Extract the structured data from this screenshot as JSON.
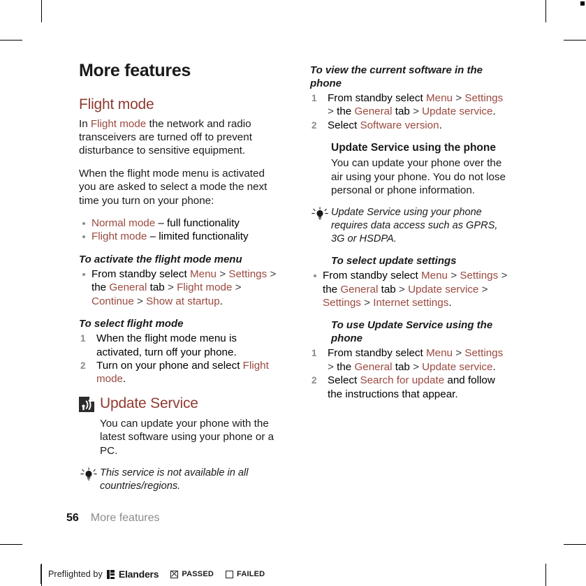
{
  "document": {
    "chapter_title": "More features",
    "folio_number": "56",
    "folio_label": "More features"
  },
  "left_column": {
    "flight_mode": {
      "heading": "Flight mode",
      "intro_pre": "In ",
      "intro_term": "Flight mode",
      "intro_post": " the network and radio transceivers are turned off to prevent disturbance to sensitive equipment.",
      "paragraph2": "When the flight mode menu is activated you are asked to select a mode the next time you turn on your phone:",
      "modes": [
        {
          "term": "Normal mode",
          "desc": " – full functionality"
        },
        {
          "term": "Flight mode",
          "desc": " – limited functionality"
        }
      ],
      "activate": {
        "title": "To activate the flight mode menu",
        "step_pre": "From standby select ",
        "menu": "Menu",
        "settings": "Settings",
        "the": "the ",
        "general": "General",
        "tab": " tab ",
        "flight_mode": "Flight mode",
        "continue": "Continue",
        "show_at_startup": "Show at startup",
        "period": "."
      },
      "select_flight": {
        "title": "To select flight mode",
        "step1": "When the flight mode menu is activated, turn off your phone.",
        "step2_pre": "Turn on your phone and select ",
        "step2_term": "Flight mode",
        "step2_post": "."
      }
    },
    "update_service": {
      "heading": "Update Service",
      "icon": "update-service-document-icon",
      "paragraph": "You can update your phone with the latest software using your phone or a PC.",
      "tip": "This service is not available in all countries/regions."
    }
  },
  "right_column": {
    "view_software": {
      "title": "To view the current software in the phone",
      "step1_pre": "From standby select ",
      "menu": "Menu",
      "settings": "Settings",
      "the": "the ",
      "general": "General",
      "tab": " tab ",
      "update_service": "Update service",
      "period": ".",
      "step2_pre": "Select ",
      "step2_term": "Software version",
      "step2_post": "."
    },
    "using_phone": {
      "title": "Update Service using the phone",
      "paragraph": "You can update your phone over the air using your phone. You do not lose personal or phone information.",
      "tip": "Update Service using your phone requires data access such as GPRS, 3G or HSDPA."
    },
    "update_settings": {
      "title": "To select update settings",
      "step_pre": "From standby select ",
      "menu": "Menu",
      "settings": "Settings",
      "the": "the ",
      "general": "General",
      "tab": " tab ",
      "update_service": "Update service",
      "settings2": "Settings",
      "internet_settings": "Internet settings",
      "period": "."
    },
    "use_update_service": {
      "title": "To use Update Service using the phone",
      "step1_pre": "From standby select ",
      "menu": "Menu",
      "settings": "Settings",
      "the": "the ",
      "general": "General",
      "tab": " tab ",
      "update_service": "Update service",
      "period": ".",
      "step2_pre": "Select ",
      "step2_term": "Search for update",
      "step2_post": " and follow the instructions that appear."
    }
  },
  "preflight": {
    "text": "Preflighted by",
    "brand": "Elanders",
    "passed": "PASSED",
    "failed": "FAILED"
  },
  "colors": {
    "accent_heading": "#8e3b31",
    "accent_inline": "#9a4a40",
    "muted": "#8b8b8b",
    "text": "#1a1a1a"
  },
  "separators": {
    "gt": ">"
  }
}
